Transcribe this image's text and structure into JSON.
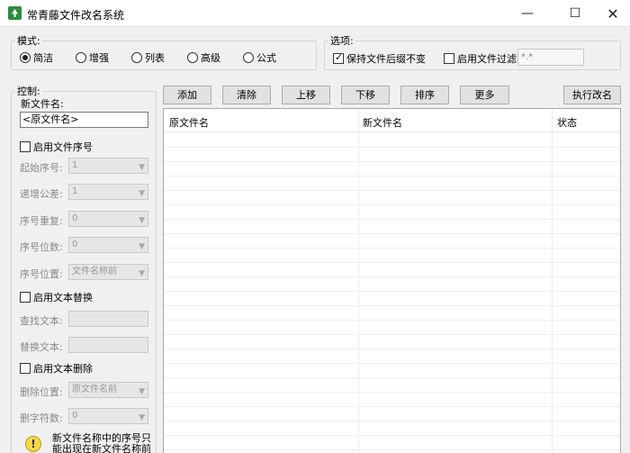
{
  "window": {
    "title": "常青藤文件改名系统",
    "minimize": "—",
    "maximize": "☐",
    "close": "✕"
  },
  "mode": {
    "legend": "模式:",
    "options": [
      {
        "label": "简洁",
        "checked": true
      },
      {
        "label": "增强",
        "checked": false
      },
      {
        "label": "列表",
        "checked": false
      },
      {
        "label": "高级",
        "checked": false
      },
      {
        "label": "公式",
        "checked": false
      }
    ]
  },
  "options": {
    "legend": "选项:",
    "keep_ext": "保持文件后缀不变",
    "enable_filter": "启用文件过滤",
    "filter_value": "*.*"
  },
  "control": {
    "legend": "控制:",
    "new_name_label": "新文件名:",
    "new_name_value": "<原文件名>",
    "enable_seq": "启用文件序号",
    "start_label": "起始序号:",
    "start_value": "1",
    "step_label": "递增公差:",
    "step_value": "1",
    "repeat_label": "序号重复:",
    "repeat_value": "0",
    "digits_label": "序号位数:",
    "digits_value": "0",
    "pos_label": "序号位置:",
    "pos_value": "文件名称前",
    "enable_replace": "启用文本替换",
    "find_label": "查找文本:",
    "replace_label": "替换文本:",
    "enable_delete": "启用文本删除",
    "del_pos_label": "删除位置:",
    "del_pos_value": "原文件名前",
    "del_count_label": "删字符数:",
    "del_count_value": "0",
    "tip_icon": "!",
    "tip_line1": "新文件名称中的序号只",
    "tip_line2": "能出现在新文件名称前"
  },
  "toolbar": {
    "add": "添加",
    "clear": "清除",
    "up": "上移",
    "down": "下移",
    "sort": "排序",
    "more": "更多",
    "execute": "执行改名"
  },
  "grid": {
    "col_original": "原文件名",
    "col_new": "新文件名",
    "col_status": "状态"
  }
}
